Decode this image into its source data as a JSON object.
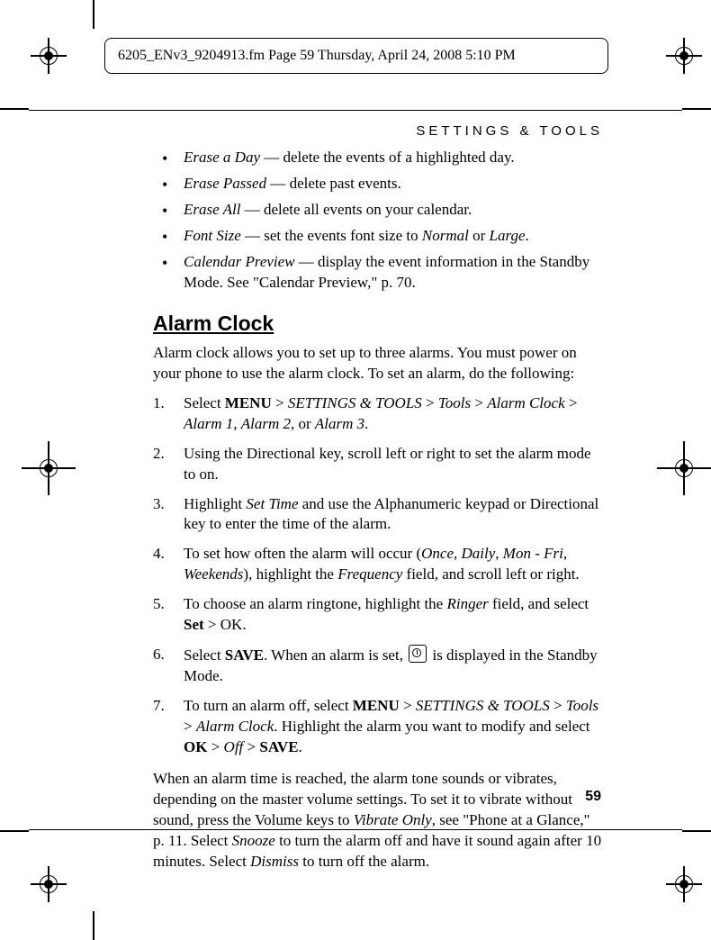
{
  "header": {
    "text": "6205_ENv3_9204913.fm  Page 59  Thursday, April 24, 2008  5:10 PM"
  },
  "section_title": "SETTINGS  &  TOOLS",
  "bullets": {
    "items": [
      {
        "term": "Erase a Day",
        "desc": " — delete the events of a highlighted day."
      },
      {
        "term": "Erase Passed",
        "desc": " — delete past events."
      },
      {
        "term": "Erase All",
        "desc": " — delete all events on your calendar."
      },
      {
        "term": "Font Size",
        "desc_pre": " — set the events font size to ",
        "opt1": "Normal",
        "mid": " or ",
        "opt2": "Large",
        "post": "."
      },
      {
        "term": "Calendar Preview",
        "desc": " — display the event information in the Standby Mode. See \"Calendar Preview,\" p. 70."
      }
    ]
  },
  "alarm": {
    "heading": "Alarm Clock",
    "intro": "Alarm clock allows you to set up to three alarms. You must power on your phone to use the alarm clock. To set an alarm, do the following:",
    "steps": {
      "s1": {
        "pre": "Select ",
        "menu": "MENU",
        "gt1": " > ",
        "p1": "SETTINGS & TOOLS",
        "gt2": " > ",
        "p2": "Tools",
        "gt3": " > ",
        "p3": "Alarm Clock",
        "gt4": " > ",
        "a1": "Alarm 1",
        "c1": ", ",
        "a2": "Alarm 2",
        "c2": ", or ",
        "a3": "Alarm 3",
        "end": "."
      },
      "s2": "Using the Directional key, scroll left or right to set the alarm mode to on.",
      "s3": {
        "pre": "Highlight ",
        "i1": "Set Time",
        "post": " and use the Alphanumeric keypad or Directional key to enter the time of the alarm."
      },
      "s4": {
        "pre": "To set how often the alarm will occur (",
        "o1": "Once",
        "c1": ", ",
        "o2": "Daily",
        "c2": ", ",
        "o3": "Mon - Fri",
        "c3": ", ",
        "o4": "Weekends",
        "mid": "), highlight the ",
        "f": "Frequency",
        "post": " field, and scroll left or right."
      },
      "s5": {
        "pre": "To choose an alarm ringtone, highlight the ",
        "r": "Ringer",
        "mid": " field, and select ",
        "set": "Set",
        "gt": " > ",
        "ok": "OK."
      },
      "s6": {
        "pre": "Select ",
        "save": "SAVE",
        "mid": ". When an alarm is set, ",
        "post": " is displayed in the Standby Mode."
      },
      "s7": {
        "pre": "To turn an alarm off, select ",
        "menu": "MENU",
        "gt1": " > ",
        "p1": "SETTINGS & TOOLS",
        "gt2": " > ",
        "p2": "Tools",
        "gt3": " > ",
        "p3": "Alarm Clock",
        "mid": ". Highlight the alarm you want to modify and select ",
        "ok": "OK",
        "gt4": " > ",
        "off": "Off",
        "gt5": " > ",
        "save": "SAVE",
        "end": "."
      }
    },
    "outro": {
      "pre": "When an alarm time is reached, the alarm tone sounds or vibrates, depending on the master volume settings. To set it to vibrate without sound, press the Volume keys to ",
      "v": "Vibrate Only",
      "mid1": ", see \"Phone at a Glance,\" p. 11. Select ",
      "sn": "Snooze",
      "mid2": " to turn the alarm off and have it sound again after 10 minutes. Select ",
      "dm": "Dismiss",
      "post": " to turn off the alarm."
    }
  },
  "page_number": "59"
}
